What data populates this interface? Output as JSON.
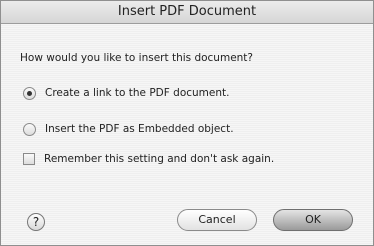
{
  "dialog": {
    "title": "Insert PDF Document",
    "question": "How would you like to insert this document?",
    "options": [
      {
        "label": "Create a link to the PDF document.",
        "selected": true
      },
      {
        "label": "Insert the PDF as Embedded object.",
        "selected": false
      }
    ],
    "remember": {
      "label": "Remember this setting and don't ask again.",
      "checked": false
    },
    "help_glyph": "?",
    "cancel_label": "Cancel",
    "ok_label": "OK"
  }
}
